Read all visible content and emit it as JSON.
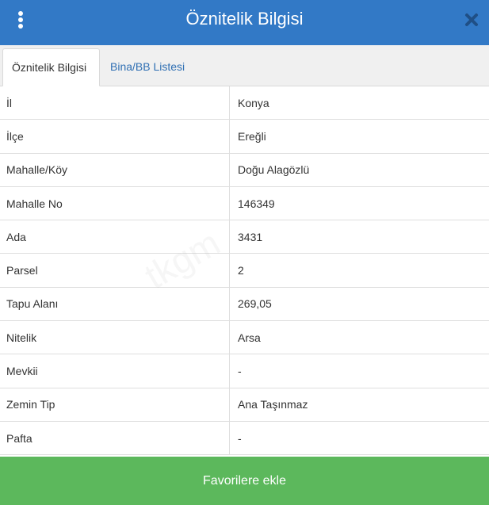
{
  "header": {
    "title": "Öznitelik Bilgisi",
    "menu_icon": "vertical-dots-icon",
    "close_icon": "close-icon"
  },
  "tabs": [
    {
      "label": "Öznitelik Bilgisi",
      "active": true
    },
    {
      "label": "Bina/BB Listesi",
      "active": false
    }
  ],
  "attributes": [
    {
      "label": "İl",
      "value": "Konya"
    },
    {
      "label": "İlçe",
      "value": "Ereğli"
    },
    {
      "label": "Mahalle/Köy",
      "value": "Doğu Alagözlü"
    },
    {
      "label": "Mahalle No",
      "value": "146349"
    },
    {
      "label": "Ada",
      "value": "3431"
    },
    {
      "label": "Parsel",
      "value": "2"
    },
    {
      "label": "Tapu Alanı",
      "value": "269,05"
    },
    {
      "label": "Nitelik",
      "value": "Arsa"
    },
    {
      "label": "Mevkii",
      "value": "-"
    },
    {
      "label": "Zemin Tip",
      "value": "Ana Taşınmaz"
    },
    {
      "label": "Pafta",
      "value": "-"
    }
  ],
  "footer": {
    "favorite_label": "Favorilere ekle"
  },
  "colors": {
    "header_bg": "#3279c6",
    "tab_link": "#2f6fb3",
    "footer_bg": "#5cb85c"
  },
  "watermark": "tkgm"
}
